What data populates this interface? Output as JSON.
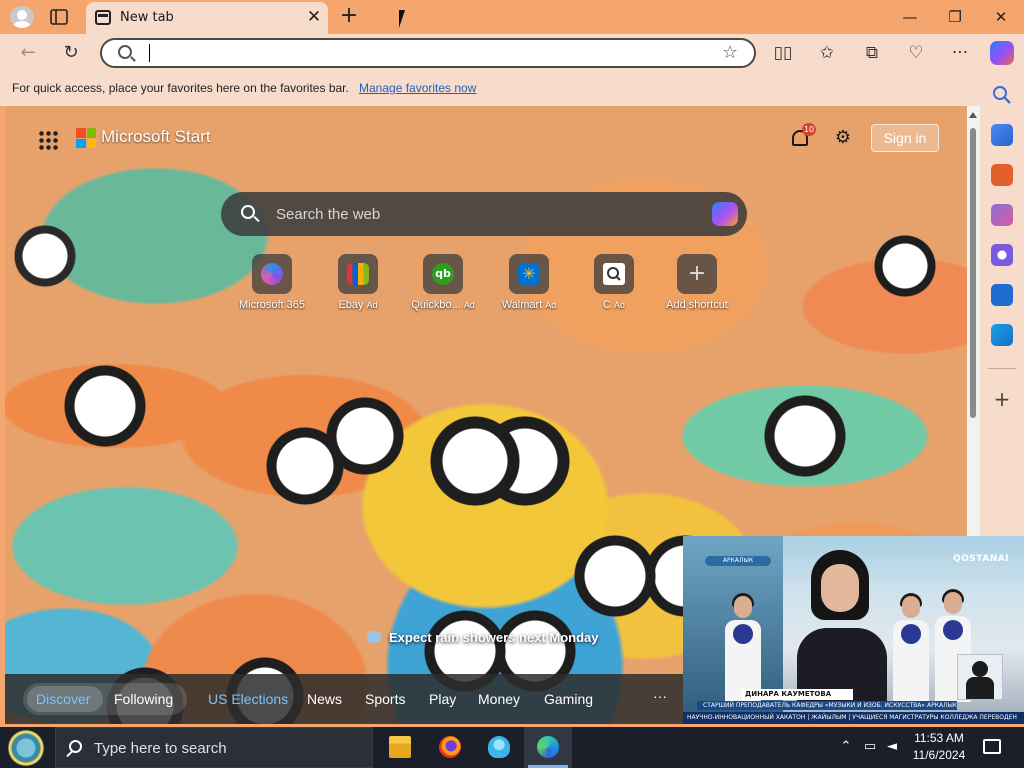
{
  "browser": {
    "tab_title": "New tab",
    "address_value": "",
    "favorites_bar": {
      "message": "For quick access, place your favorites here on the favorites bar.",
      "link": "Manage favorites now"
    }
  },
  "newtab": {
    "brand": "Microsoft Start",
    "notification_count": "10",
    "signin_label": "Sign in",
    "search_placeholder": "Search the web",
    "shortcuts": [
      {
        "label": "Microsoft 365",
        "ad": "",
        "icon": "microsoft365-icon",
        "color": "#6a54d8"
      },
      {
        "label": "Ebay",
        "ad": "Ad",
        "icon": "ebay-icon",
        "color": "#2f7de1"
      },
      {
        "label": "Quickbo...",
        "ad": "Ad",
        "icon": "quickbooks-icon",
        "color": "#2ca01c"
      },
      {
        "label": "Walmart",
        "ad": "Ad",
        "icon": "walmart-icon",
        "color": "#0071ce"
      },
      {
        "label": "C",
        "ad": "Ad",
        "icon": "search-shortcut-icon",
        "color": "#ffffff"
      },
      {
        "label": "Add shortcut",
        "ad": "",
        "icon": "plus-icon",
        "color": "#cfcfcf"
      }
    ],
    "weather_message": "Expect rain showers next Monday",
    "feed_tabs": {
      "discover": "Discover",
      "following": "Following"
    },
    "categories": [
      "US Elections",
      "News",
      "Sports",
      "Play",
      "Money",
      "Gaming"
    ],
    "more": "···"
  },
  "video": {
    "brand": "QOSTANAI",
    "place_tag": "АРКАЛЫК",
    "name": "ДИНАРА КАУМЕТОВА",
    "subtitle": "СТАРШИЙ ПРЕПОДАВАТЕЛЬ КАФЕДРЫ «МУЗЫКИ И ИЗОБ. ИСКУССТВА» АРКАЛЫКСКОГО ПЕДАГОГИЧЕСКОГО ИНСТИ",
    "ticker": "НАУЧНО-ИННОВАЦИОННЫЙ ХАКАТОН  |  ЖАЙЫЛЫМ  |  УЧАЩИЕСЯ МАГИСТРАТУРЫ КОЛЛЕДЖА ПЕРЕВОДЕН"
  },
  "taskbar": {
    "search_placeholder": "Type here to search",
    "time": "11:53 AM",
    "date": "11/6/2024"
  },
  "colors": {
    "frame": "#f5a66f",
    "toolbar": "#f7dccb",
    "link": "#1f5fbf",
    "active_category": "#7cc2ff",
    "taskbar": "#1b1f2a"
  }
}
